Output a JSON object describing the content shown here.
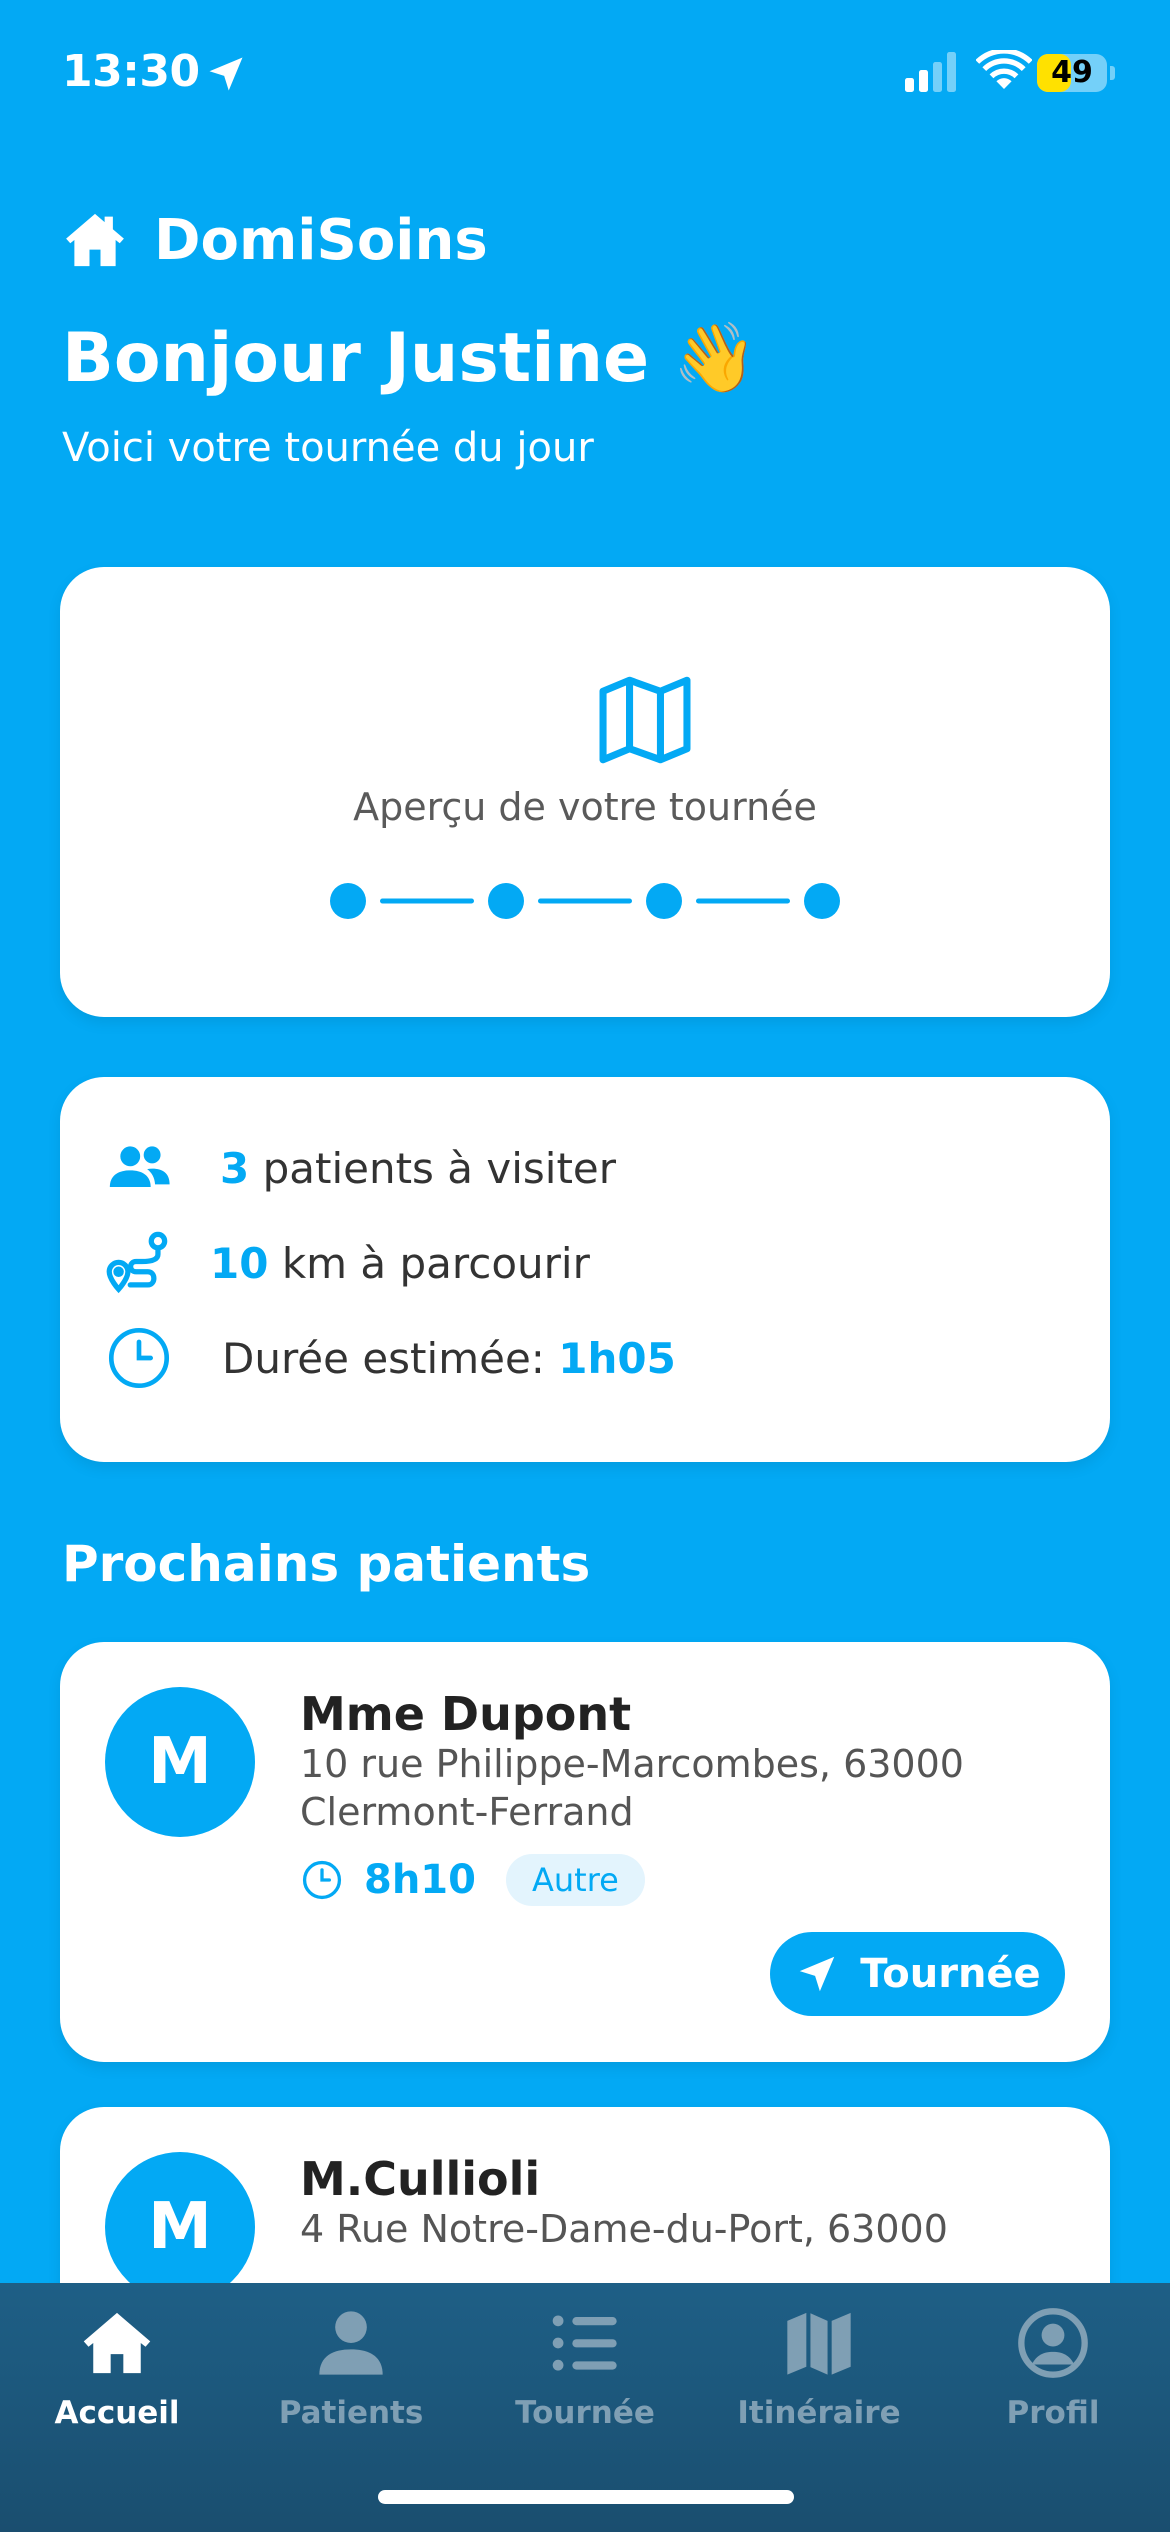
{
  "status_bar": {
    "time": "13:30",
    "battery": "49",
    "battery_level": 0.49
  },
  "header": {
    "app_name": "DomiSoins",
    "greeting": "Bonjour Justine 👋",
    "subtitle": "Voici votre tournée du jour"
  },
  "overview": {
    "label": "Aperçu de votre tournée",
    "stops": 4
  },
  "stats": {
    "patients_count": "3",
    "patients_label": "patients à visiter",
    "distance_value": "10",
    "distance_label": "km à parcourir",
    "duration_label": "Durée estimée:",
    "duration_value": "1h05"
  },
  "next_patients": {
    "title": "Prochains patients",
    "items": [
      {
        "initial": "M",
        "name": "Mme Dupont",
        "address": "10 rue Philippe-Marcombes, 63000 Clermont-Ferrand",
        "time": "8h10",
        "tag": "Autre",
        "button": "Tournée"
      },
      {
        "initial": "M",
        "name": "M.Cullioli",
        "address": "4 Rue Notre-Dame-du-Port, 63000",
        "time": "",
        "tag": "",
        "button": ""
      }
    ]
  },
  "tabbar": {
    "items": [
      {
        "label": "Accueil",
        "icon": "home-icon",
        "active": true
      },
      {
        "label": "Patients",
        "icon": "person-icon",
        "active": false
      },
      {
        "label": "Tournée",
        "icon": "list-icon",
        "active": false
      },
      {
        "label": "Itinéraire",
        "icon": "map-icon",
        "active": false
      },
      {
        "label": "Profil",
        "icon": "profile-icon",
        "active": false
      }
    ]
  },
  "colors": {
    "primary": "#03A9F4",
    "tabbar": "#1E5F86",
    "inactive_tab": "#7F9FB4"
  }
}
